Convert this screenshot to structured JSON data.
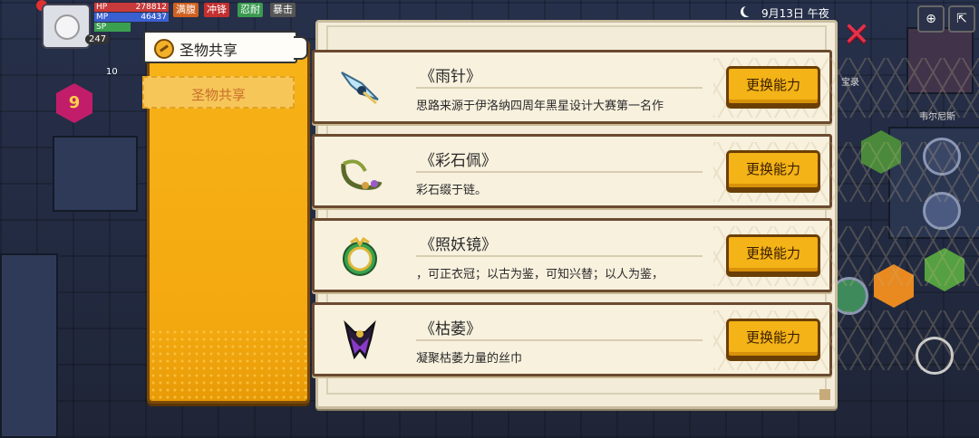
{
  "hud": {
    "hp_label": "HP",
    "hp_value": "278812",
    "mp_label": "MP",
    "mp_value": "46437",
    "sp_label": "SP",
    "level": "247",
    "status_effects": [
      "满腹",
      "冲锋",
      "忍耐",
      "暴击"
    ],
    "count": "10",
    "hex_badge": "9"
  },
  "top_right": {
    "date": "9月13日 午夜"
  },
  "side_labels": {
    "treasure": "宝录",
    "venice": "韦尔尼斯"
  },
  "sidebar": {
    "active_tab": "圣物共享",
    "items": [
      {
        "label": "圣物共享"
      }
    ]
  },
  "relics": [
    {
      "name": "《雨针》",
      "description": "思路来源于伊洛纳四周年黑星设计大赛第一名作",
      "button": "更换能力",
      "icon": "blade-icon"
    },
    {
      "name": "《彩石佩》",
      "description": "彩石缀于链。",
      "button": "更换能力",
      "icon": "necklace-icon"
    },
    {
      "name": "《照妖镜》",
      "description": "，可正衣冠；以古为鉴，可知兴替；以人为鉴，",
      "button": "更换能力",
      "icon": "mirror-icon"
    },
    {
      "name": "《枯萎》",
      "description": "凝聚枯萎力量的丝巾",
      "button": "更换能力",
      "icon": "scarf-icon"
    }
  ],
  "colors": {
    "accent": "#f4b316",
    "panel": "#f3ecd9",
    "close": "#e5314a"
  }
}
